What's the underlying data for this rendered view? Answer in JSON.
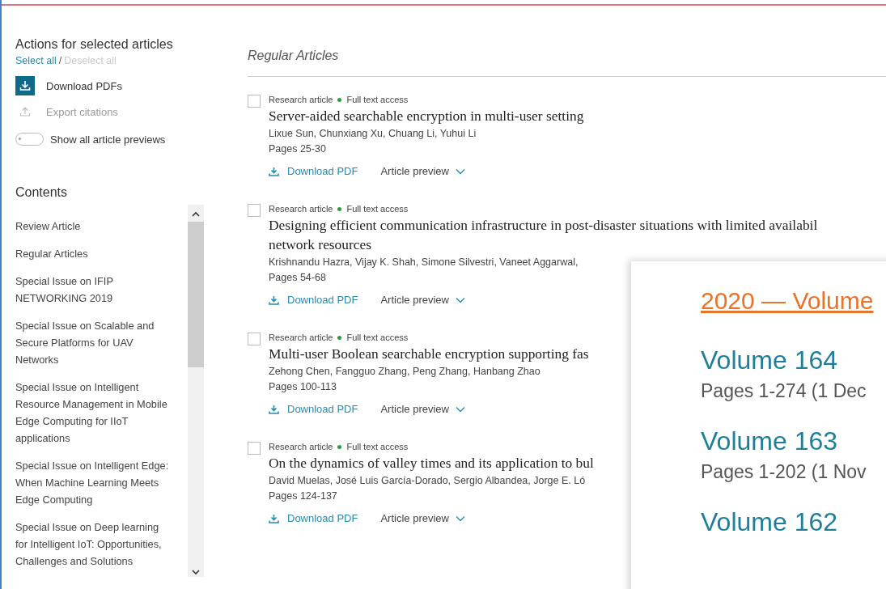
{
  "sidebar": {
    "actions_title": "Actions for selected articles",
    "select_all": "Select all",
    "separator": "/",
    "deselect_all": {
      "label": "Deselect all",
      "disabled": true
    },
    "actions": [
      {
        "label": "Download PDFs",
        "disabled": false
      },
      {
        "label": "Export citations",
        "disabled": true
      }
    ],
    "preview_toggle": {
      "label": "Show all article previews",
      "on": false
    },
    "contents_title": "Contents",
    "contents": [
      "Review Article",
      "Regular Articles",
      "Special Issue on IFIP NETWORKING 2019",
      "Special Issue on Scalable and Secure Platforms for UAV Networks",
      "Special Issue on Intelligent Resource Management in Mobile Edge Computing for IIoT applications",
      "Special Issue on Intelligent Edge: When Machine Learning Meets Edge Computing",
      "Special Issue on Deep learning for Intelligent IoT: Opportunities, Challenges and Solutions"
    ]
  },
  "section_title": "Regular Articles",
  "articles": [
    {
      "checked": false,
      "type": "Research article",
      "access": "Full text access",
      "title_lines": [
        "Server-aided searchable encryption in multi-user setting"
      ],
      "authors": "Lixue Sun, Chunxiang Xu, Chuang Li, Yuhui Li",
      "pages": "Pages 25-30",
      "download": "Download PDF",
      "preview": "Article preview"
    },
    {
      "checked": false,
      "type": "Research article",
      "access": "Full text access",
      "title_lines": [
        "Designing efficient communication infrastructure in post-disaster situations with limited availabil",
        "network resources"
      ],
      "authors": "Krishnandu Hazra, Vijay K. Shah, Simone Silvestri, Vaneet Aggarwal,",
      "pages": "Pages 54-68",
      "download": "Download PDF",
      "preview": "Article preview"
    },
    {
      "checked": false,
      "type": "Research article",
      "access": "Full text access",
      "title_lines": [
        "Multi-user Boolean searchable encryption supporting fas"
      ],
      "authors": "Zehong Chen, Fangguo Zhang, Peng Zhang, Hanbang Zhao",
      "pages": "Pages 100-113",
      "download": "Download PDF",
      "preview": "Article preview"
    },
    {
      "checked": false,
      "type": "Research article",
      "access": "Full text access",
      "title_lines": [
        "On the dynamics of valley times and its application to bul"
      ],
      "authors": "David Muelas, José Luis García-Dorado, Sergio Albandea, Jorge E. Ló",
      "pages": "Pages 124-137",
      "download": "Download PDF",
      "preview": "Article preview"
    }
  ],
  "volume_panel": {
    "heading": "2020 — Volume",
    "volumes": [
      {
        "name": "Volume 164",
        "pages": "Pages 1-274 (1 Dec"
      },
      {
        "name": "Volume 163",
        "pages": "Pages 1-202 (1 Nov"
      },
      {
        "name": "Volume 162"
      }
    ]
  }
}
